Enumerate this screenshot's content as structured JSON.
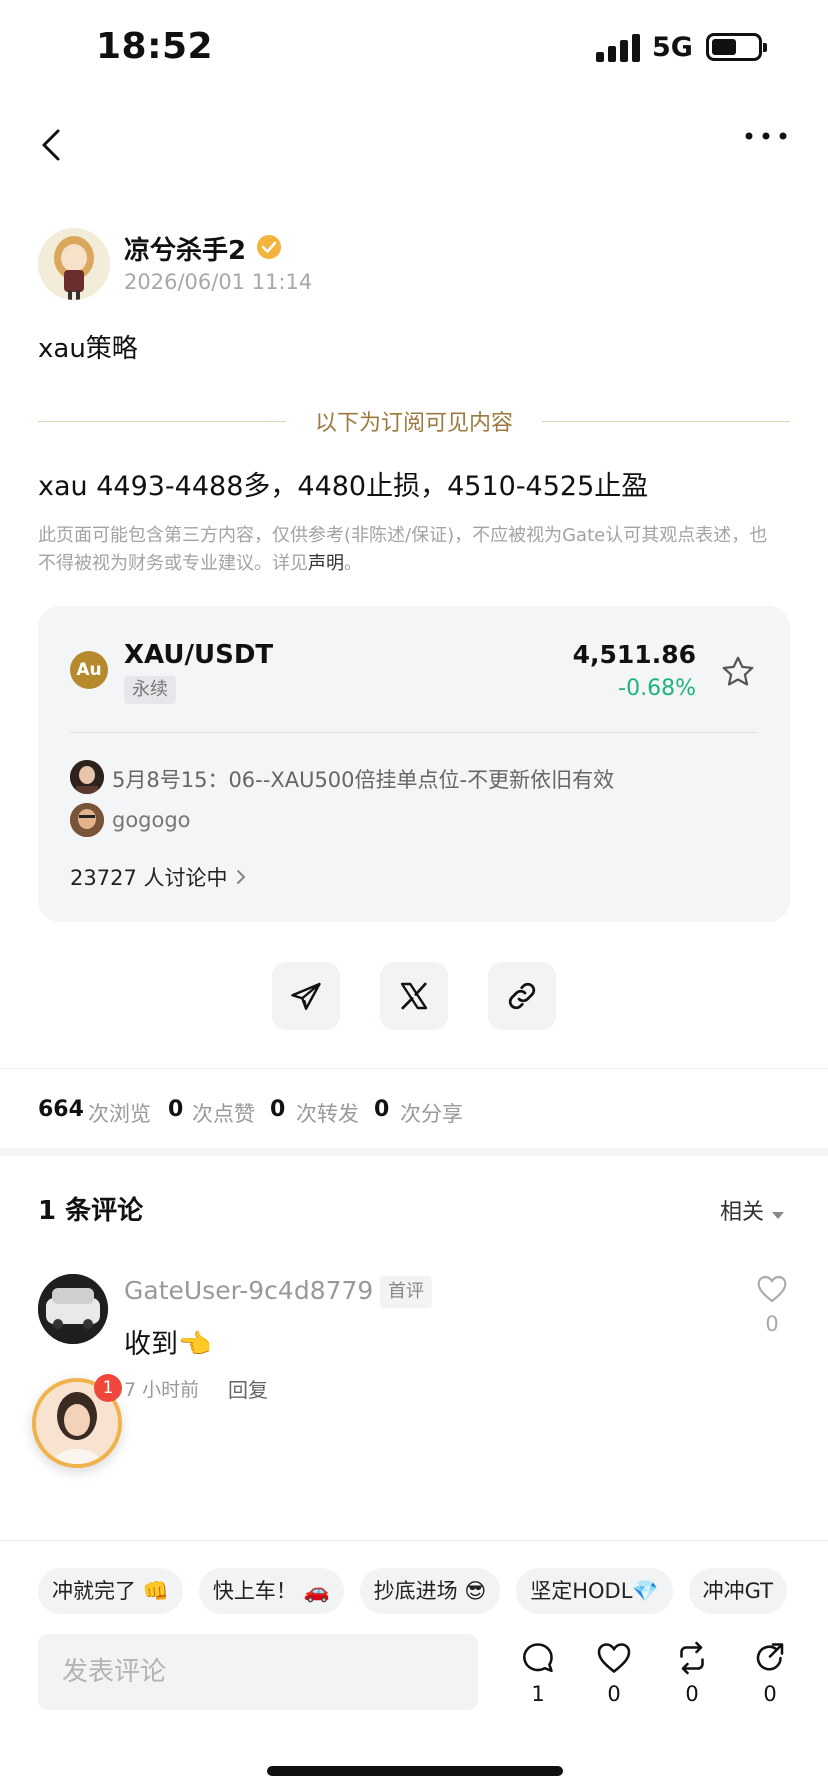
{
  "status_bar": {
    "time": "18:52",
    "network": "5G"
  },
  "post": {
    "author": "凉兮杀手2",
    "timestamp": "2026/06/01 11:14",
    "title": "xau策略",
    "divider_text": "以下为订阅可见内容",
    "strategy": "xau 4493-4488多，4480止损，4510-4525止盈",
    "disclaimer": "此页面可能包含第三方内容，仅供参考(非陈述/保证)，不应被视为Gate认可其观点表述，也不得被视为财务或专业建议。详见",
    "disclaimer_link": "声明",
    "disclaimer_end": "。"
  },
  "ticker": {
    "icon_text": "Au",
    "pair": "XAU/USDT",
    "tag": "永续",
    "price": "4,511.86",
    "change": "-0.68%",
    "change_color": "#1db37a",
    "discussions": [
      {
        "text": "5月8号15：06--XAU500倍挂单点位-不更新依旧有效"
      },
      {
        "text": "gogogo"
      }
    ],
    "discussion_count": "23727 人讨论中"
  },
  "share": [
    "telegram-icon",
    "x-icon",
    "link-icon"
  ],
  "stats": [
    {
      "num": "664",
      "label": "次浏览"
    },
    {
      "num": "0",
      "label": "次点赞"
    },
    {
      "num": "0",
      "label": "次转发"
    },
    {
      "num": "0",
      "label": "次分享"
    }
  ],
  "comments": {
    "title": "1 条评论",
    "sort": "相关",
    "items": [
      {
        "user": "GateUser-9c4d8779",
        "badge": "首评",
        "text": "收到👈",
        "time": "7 小时前",
        "reply": "回复",
        "likes": "0"
      }
    ]
  },
  "floating_badge": "1",
  "quick_replies": [
    "冲就完了 👊",
    "快上车！ 🚗",
    "抄底进场 😎",
    "坚定HODL💎",
    "冲冲GT"
  ],
  "comment_input": {
    "placeholder": "发表评论"
  },
  "actions": {
    "comment": "1",
    "like": "0",
    "repost": "0",
    "share": "0"
  },
  "colors": {
    "accent_gold": "#9c7a3f",
    "positive": "#1db37a",
    "badge_red": "#f0473c"
  }
}
